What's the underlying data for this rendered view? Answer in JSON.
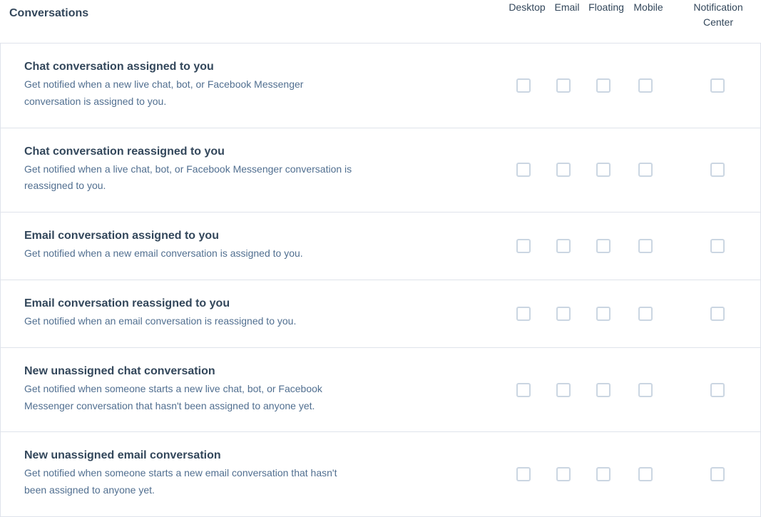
{
  "section": {
    "title": "Conversations"
  },
  "columns": {
    "desktop": "Desktop",
    "email": "Email",
    "floating": "Floating",
    "mobile": "Mobile",
    "notification_center": "Notification Center"
  },
  "rows": [
    {
      "title": "Chat conversation assigned to you",
      "description": "Get notified when a new live chat, bot, or Facebook Messenger conversation is assigned to you.",
      "checked": {
        "desktop": false,
        "email": false,
        "floating": false,
        "mobile": false,
        "notification_center": false
      }
    },
    {
      "title": "Chat conversation reassigned to you",
      "description": "Get notified when a live chat, bot, or Facebook Messenger conversation is reassigned to you.",
      "checked": {
        "desktop": false,
        "email": false,
        "floating": false,
        "mobile": false,
        "notification_center": false
      }
    },
    {
      "title": "Email conversation assigned to you",
      "description": "Get notified when a new email conversation is assigned to you.",
      "checked": {
        "desktop": false,
        "email": false,
        "floating": false,
        "mobile": false,
        "notification_center": false
      }
    },
    {
      "title": "Email conversation reassigned to you",
      "description": "Get notified when an email conversation is reassigned to you.",
      "checked": {
        "desktop": false,
        "email": false,
        "floating": false,
        "mobile": false,
        "notification_center": false
      }
    },
    {
      "title": "New unassigned chat conversation",
      "description": "Get notified when someone starts a new live chat, bot, or Facebook Messenger conversation that hasn't been assigned to anyone yet.",
      "checked": {
        "desktop": false,
        "email": false,
        "floating": false,
        "mobile": false,
        "notification_center": false
      }
    },
    {
      "title": "New unassigned email conversation",
      "description": "Get notified when someone starts a new email conversation that hasn't been assigned to anyone yet.",
      "checked": {
        "desktop": false,
        "email": false,
        "floating": false,
        "mobile": false,
        "notification_center": false
      }
    }
  ]
}
